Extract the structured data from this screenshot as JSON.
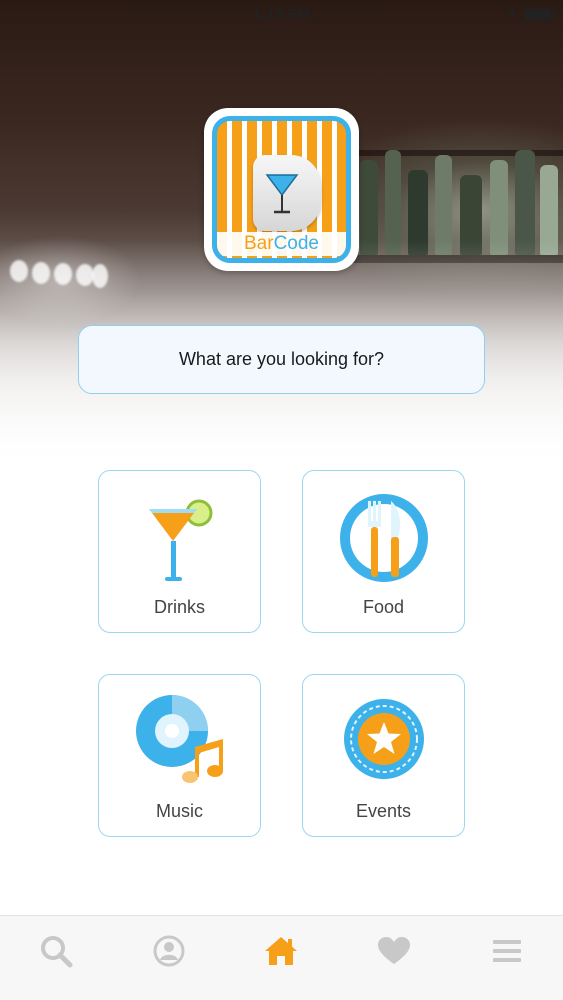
{
  "status_bar": {
    "time": "1:15 PM"
  },
  "logo": {
    "text_bar": "Bar",
    "text_code": "Code"
  },
  "search": {
    "prompt": "What are you looking for?"
  },
  "categories": [
    {
      "label": "Drinks",
      "icon": "cocktail-icon"
    },
    {
      "label": "Food",
      "icon": "fork-knife-plate-icon"
    },
    {
      "label": "Music",
      "icon": "disc-music-note-icon"
    },
    {
      "label": "Events",
      "icon": "star-badge-icon"
    }
  ],
  "tab_bar": {
    "items": [
      {
        "icon": "search-icon",
        "active": false
      },
      {
        "icon": "profile-icon",
        "active": false
      },
      {
        "icon": "home-icon",
        "active": true
      },
      {
        "icon": "heart-icon",
        "active": false
      },
      {
        "icon": "menu-icon",
        "active": false
      }
    ]
  },
  "colors": {
    "accent_orange": "#f6a01a",
    "accent_blue": "#3db1ea",
    "inactive_icon": "#c8c8c8"
  }
}
